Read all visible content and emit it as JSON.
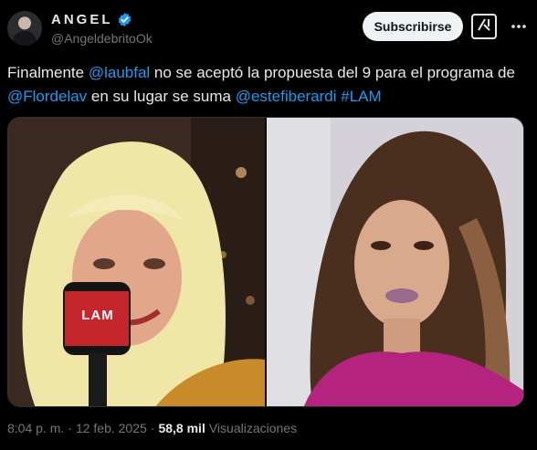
{
  "author": {
    "display_name": "ANGEL",
    "handle": "@AngeldebritoOk"
  },
  "actions": {
    "subscribe_label": "Subscribirse"
  },
  "tweet": {
    "text_1": "Finalmente ",
    "mention_1": "@laubfal",
    "text_2": " no se aceptó la propuesta del 9 para el programa de ",
    "mention_2": "@Flordelav",
    "text_3": "  en su lugar se suma ",
    "mention_3": "@estefiberardi",
    "text_4": " ",
    "hashtag_1": "#LAM"
  },
  "media": {
    "microphone_logo": "LAM"
  },
  "meta": {
    "time": "8:04 p. m.",
    "separator": "·",
    "date": "12 feb. 2025",
    "views_count": "58,8 mil",
    "views_label": "Visualizaciones"
  },
  "colors": {
    "link": "#1d9bf0",
    "verified": "#1d9bf0",
    "background": "#000000"
  }
}
